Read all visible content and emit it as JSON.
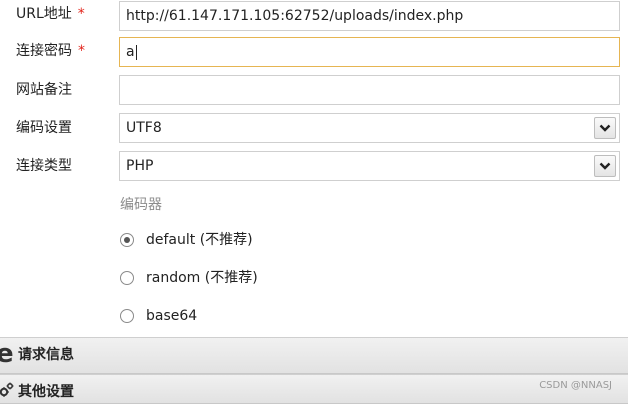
{
  "form": {
    "url": {
      "label": "URL地址",
      "required_mark": "*",
      "value": "http://61.147.171.105:62752/uploads/index.php"
    },
    "password": {
      "label": "连接密码",
      "required_mark": "*",
      "value": "a"
    },
    "note": {
      "label": "网站备注",
      "value": ""
    },
    "encoding": {
      "label": "编码设置",
      "value": "UTF8"
    },
    "conn_type": {
      "label": "连接类型",
      "value": "PHP"
    }
  },
  "encoder": {
    "heading": "编码器",
    "options": [
      {
        "label": "default (不推荐)",
        "checked": true
      },
      {
        "label": "random (不推荐)",
        "checked": false
      },
      {
        "label": "base64",
        "checked": false
      }
    ]
  },
  "panels": [
    {
      "title": "请求信息",
      "icon": "e-icon"
    },
    {
      "title": "其他设置",
      "icon": "gears-icon"
    }
  ],
  "watermark": "CSDN @NNASJ",
  "colors": {
    "required": "#e2231a",
    "focus_border": "#e6b552"
  }
}
